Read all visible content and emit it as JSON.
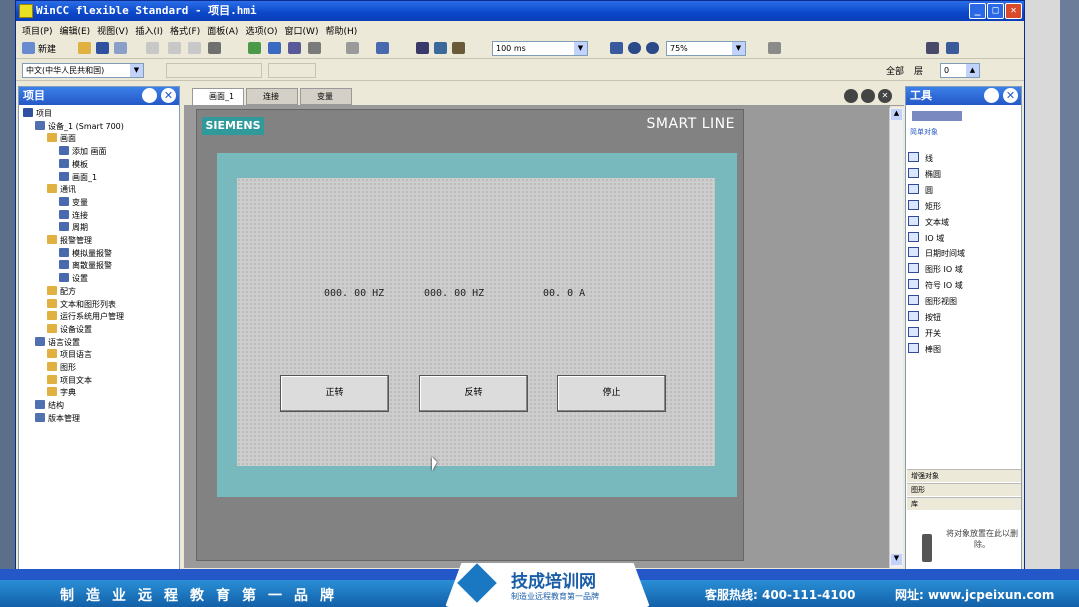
{
  "window": {
    "title": "WinCC flexible Standard - 项目.hmi"
  },
  "menu": [
    "项目(P)",
    "编辑(E)",
    "视图(V)",
    "插入(I)",
    "格式(F)",
    "面板(A)",
    "选项(O)",
    "窗口(W)",
    "帮助(H)"
  ],
  "toolbar": {
    "new_label": "新建",
    "cycle_value": "100 ms",
    "zoom_value": "75%",
    "language_value": "中文(中华人民共和国)",
    "layer_label": "全部",
    "layer_name": "层",
    "layer_value": "0"
  },
  "project_panel": {
    "title": "项目",
    "tree": [
      {
        "label": "项目",
        "level": 0
      },
      {
        "label": "设备_1 (Smart 700)",
        "level": 1
      },
      {
        "label": "画面",
        "level": 2
      },
      {
        "label": "添加 画面",
        "level": 3
      },
      {
        "label": "模板",
        "level": 3
      },
      {
        "label": "画面_1",
        "level": 3
      },
      {
        "label": "通讯",
        "level": 2
      },
      {
        "label": "变量",
        "level": 3
      },
      {
        "label": "连接",
        "level": 3
      },
      {
        "label": "周期",
        "level": 3
      },
      {
        "label": "报警管理",
        "level": 2
      },
      {
        "label": "模拟量报警",
        "level": 3
      },
      {
        "label": "离散量报警",
        "level": 3
      },
      {
        "label": "设置",
        "level": 3
      },
      {
        "label": "配方",
        "level": 2
      },
      {
        "label": "文本和图形列表",
        "level": 2
      },
      {
        "label": "运行系统用户管理",
        "level": 2
      },
      {
        "label": "设备设置",
        "level": 2
      },
      {
        "label": "语言设置",
        "level": 1
      },
      {
        "label": "项目语言",
        "level": 2
      },
      {
        "label": "图形",
        "level": 2
      },
      {
        "label": "项目文本",
        "level": 2
      },
      {
        "label": "字典",
        "level": 2
      },
      {
        "label": "结构",
        "level": 1
      },
      {
        "label": "版本管理",
        "level": 1
      }
    ]
  },
  "editor_tabs": [
    {
      "label": "画面_1",
      "active": true
    },
    {
      "label": "连接",
      "active": false
    },
    {
      "label": "变量",
      "active": false
    }
  ],
  "hmi": {
    "brand": "SIEMENS",
    "model": "SMART LINE",
    "io_fields": [
      "000. 00 HZ",
      "000. 00 HZ",
      "00. 0 A"
    ],
    "buttons": [
      "正转",
      "反转",
      "停止"
    ]
  },
  "tools_panel": {
    "title": "工具",
    "section_simple": "简单对象",
    "items": [
      "线",
      "椭圆",
      "圆",
      "矩形",
      "文本域",
      "IO 域",
      "日期时间域",
      "图形 IO 域",
      "符号 IO 域",
      "图形视图",
      "按钮",
      "开关",
      "棒图"
    ],
    "section_enhanced": "增强对象",
    "section_graphics": "图形",
    "section_library": "库",
    "drop_hint": "将对象放置在此以删除。"
  },
  "footer": {
    "slogan": "制造业远程教育第一品牌",
    "logo_name": "技成培训网",
    "logo_tagline": "制造业远程教育第一品牌",
    "hotline": "客服热线: 400-111-4100",
    "website": "网址: www.jcpeixun.com"
  },
  "colors": {
    "accent": "#2458c8",
    "hmi_frame": "#77b9bd",
    "brand_teal": "#2f9a99",
    "footer": "#1a78c2"
  }
}
